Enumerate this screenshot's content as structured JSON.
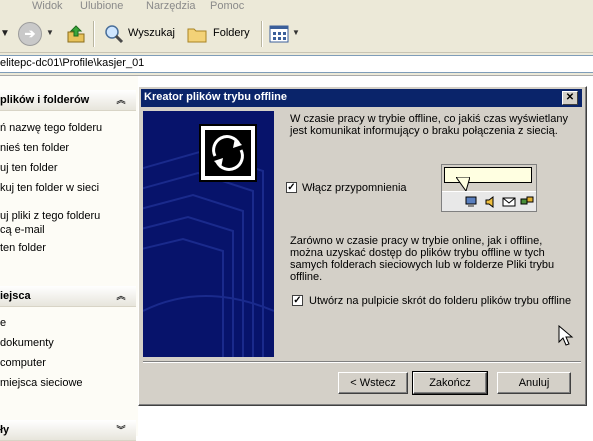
{
  "menubar": {
    "items": [
      "Widok",
      "Ulubione",
      "Narzędzia",
      "Pomoc"
    ]
  },
  "toolbar": {
    "search_label": "Wyszukaj",
    "folders_label": "Foldery"
  },
  "address": {
    "path": "elitepc-dc01\\Profile\\kasjer_01"
  },
  "taskpane": {
    "section1": {
      "title": "plików i folderów",
      "items": [
        "ń nazwę tego folderu",
        "nieś ten folder",
        "uj ten folder",
        "kuj ten folder w sieci",
        "uj pliki z tego folderu",
        "cą e-mail",
        " ten folder"
      ]
    },
    "section2": {
      "title": "iejsca",
      "items": [
        "e",
        " dokumenty",
        "computer",
        " miejsca sieciowe"
      ]
    },
    "section3": {
      "title": "ły"
    }
  },
  "dialog": {
    "title": "Kreator plików trybu offline",
    "intro": "W czasie pracy w trybie offline, co jakiś czas wyświetlany jest komunikat informujący o braku połączenia z siecią.",
    "reminder_label": "Włącz przypomnienia",
    "reminder_checked": true,
    "body": "Zarówno w czasie pracy w trybie online, jak i offline, można uzyskać dostęp do plików trybu offline w tych samych folderach sieciowych lub w folderze Pliki trybu offline.",
    "shortcut_label": "Utwórz na pulpicie skrót do folderu plików trybu offline",
    "shortcut_checked": true,
    "back_label": "< Wstecz",
    "finish_label": "Zakończ",
    "cancel_label": "Anuluj"
  },
  "colors": {
    "titlebar": "#0a246a",
    "wizard_panel": "#07136b",
    "dialog_face": "#d4d0c8"
  }
}
